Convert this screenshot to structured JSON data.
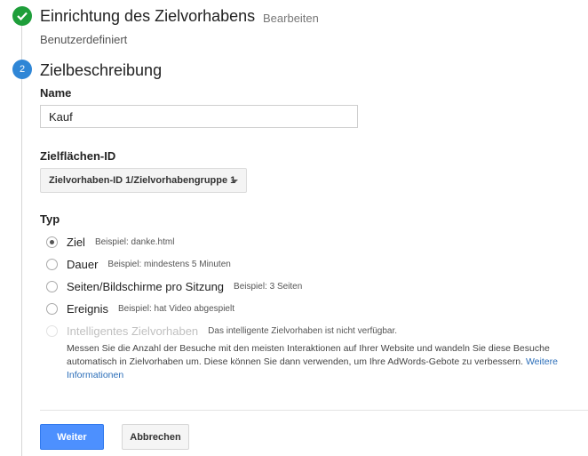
{
  "step1": {
    "number": "1",
    "title": "Einrichtung des Zielvorhabens",
    "edit_link": "Bearbeiten",
    "subtitle": "Benutzerdefiniert"
  },
  "step2": {
    "number": "2",
    "title": "Zielbeschreibung",
    "name_label": "Name",
    "name_value": "Kauf",
    "slot_label": "Zielflächen-ID",
    "slot_value": "Zielvorhaben-ID 1/Zielvorhabengruppe 1",
    "type_label": "Typ",
    "types": [
      {
        "label": "Ziel",
        "example": "Beispiel: danke.html",
        "checked": true
      },
      {
        "label": "Dauer",
        "example": "Beispiel: mindestens 5 Minuten",
        "checked": false
      },
      {
        "label": "Seiten/Bildschirme pro Sitzung",
        "example": "Beispiel: 3 Seiten",
        "checked": false
      },
      {
        "label": "Ereignis",
        "example": "Beispiel: hat Video abgespielt",
        "checked": false
      },
      {
        "label": "Intelligentes Zielvorhaben",
        "example": "Das intelligente Zielvorhaben ist nicht verfügbar.",
        "checked": false,
        "disabled": true
      }
    ],
    "smart_goal_description": "Messen Sie die Anzahl der Besuche mit den meisten Interaktionen auf Ihrer Website und wandeln Sie diese Besuche automatisch in Zielvorhaben um. Diese können Sie dann verwenden, um Ihre AdWords-Gebote zu verbessern.",
    "more_info_link": "Weitere Informationen"
  },
  "buttons": {
    "continue": "Weiter",
    "cancel": "Abbrechen"
  },
  "colors": {
    "step_done": "#1e9e3a",
    "step_active": "#2f86d6",
    "primary_button": "#4d90fe",
    "link": "#2a6db8"
  }
}
